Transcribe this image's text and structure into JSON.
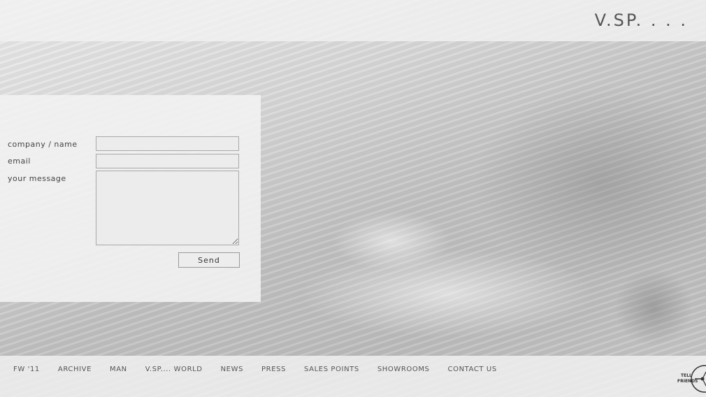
{
  "header": {
    "logo": "V.SP. . . ."
  },
  "contact_form": {
    "labels": {
      "name": "company / name",
      "email": "email",
      "message": "your message"
    },
    "values": {
      "name": "",
      "email": "",
      "message": ""
    },
    "send_label": "Send"
  },
  "nav": {
    "items": [
      {
        "label": "FW '11"
      },
      {
        "label": "ARCHIVE"
      },
      {
        "label": "MAN"
      },
      {
        "label": "V.SP.... WORLD"
      },
      {
        "label": "NEWS"
      },
      {
        "label": "PRESS"
      },
      {
        "label": "SALES POINTS"
      },
      {
        "label": "SHOWROOMS"
      },
      {
        "label": "CONTACT US"
      }
    ]
  },
  "tell_friends": {
    "line1": "TELL",
    "line2": "FRIENDS"
  },
  "colors": {
    "text": "#555555",
    "panel": "#f2f2f2",
    "field_border": "#a8a8a8"
  }
}
